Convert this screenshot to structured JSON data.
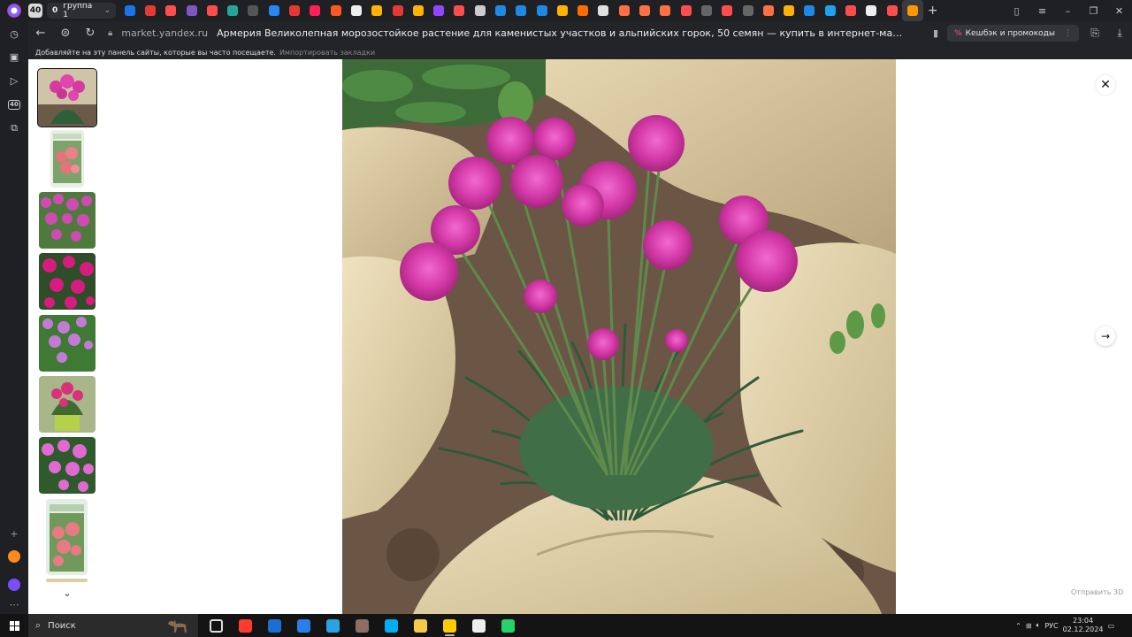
{
  "browser": {
    "tab_count": "40",
    "group": {
      "count": "0",
      "name": "группа 1"
    },
    "address": {
      "domain": "market.yandex.ru",
      "page_title": "Армерия Великолепная морозостойкое растение для каменистых участков и альпийских горок, 50 семян — купить в интернет-магазине на Яндекс Марк..."
    },
    "cashback_label": "Кешбэк и промокоды",
    "bookmarks_hint": "Добавляйте на эту панель сайты, которые вы часто посещаете.",
    "bookmarks_import": "Импортировать закладки",
    "sidebar_badge": "40",
    "pinned_tab_colors": [
      "#1a73e8",
      "#e53935",
      "#ff4d4d",
      "#7e57c2",
      "#ff4d4d",
      "#26a69a",
      "#555555",
      "#2787f5",
      "#e53935",
      "#ff1f5a",
      "#ff5722",
      "#eeeeee",
      "#ffb300",
      "#e53935",
      "#ffb300",
      "#9146ff",
      "#ff4d4d",
      "#cccccc",
      "#1e88e5",
      "#1e88e5",
      "#1e88e5",
      "#ffb300",
      "#ff6d00",
      "#e0e0e0",
      "#ff7043",
      "#ff7043",
      "#ff7043",
      "#ff4d4d",
      "#666666",
      "#ff4d4d",
      "#666666",
      "#ff7043",
      "#ffb300",
      "#1e88e5",
      "#1da1f2",
      "#ff4d4d",
      "#eeeeee",
      "#ff4d4d",
      "#ff9800"
    ]
  },
  "viewer": {
    "next_icon": "arrow-right-icon",
    "close_icon": "close-icon",
    "send_3d_label": "Отправить 3D"
  },
  "taskbar": {
    "search_label": "Поиск",
    "language": "РУС",
    "time": "23:04",
    "date": "02.12.2024",
    "app_colors": [
      "#dddddd",
      "#ff3b30",
      "#1b6fd1",
      "#2b7de9",
      "#2aa3e0",
      "#8d6e63",
      "#00aff0",
      "#f7c948",
      "#ffcc00",
      "#eeeeee",
      "#25d366"
    ]
  }
}
